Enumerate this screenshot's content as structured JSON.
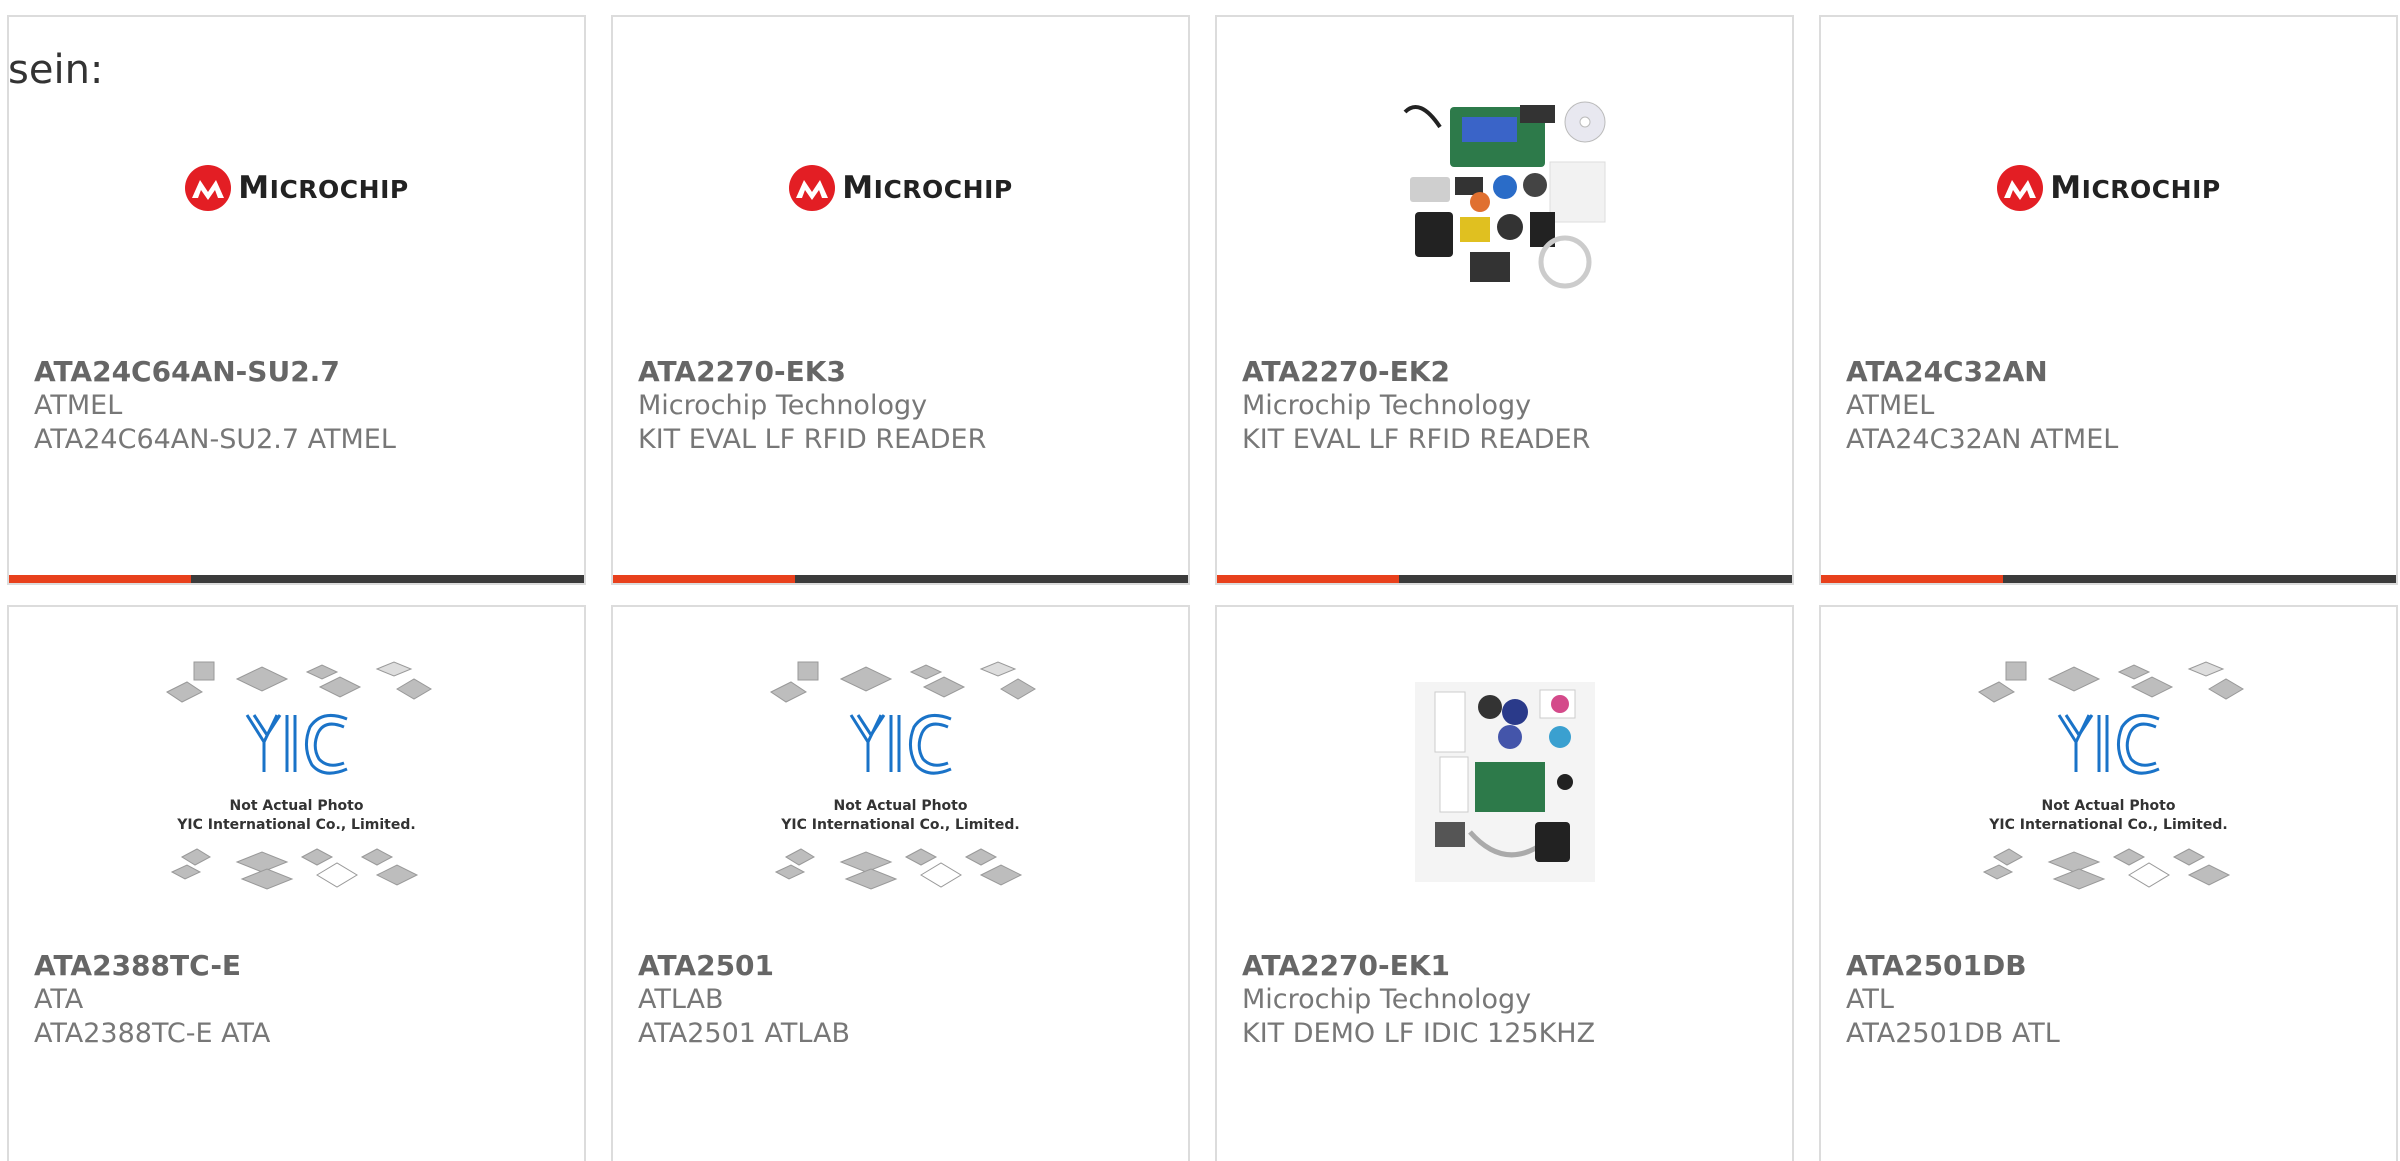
{
  "intro_text": "sein:",
  "products": [
    {
      "part": "ATA24C64AN-SU2.7",
      "manufacturer": "ATMEL",
      "description": "ATA24C64AN-SU2.7 ATMEL",
      "image": "microchip-logo"
    },
    {
      "part": "ATA2270-EK3",
      "manufacturer": "Microchip Technology",
      "description": "KIT EVAL LF RFID READER",
      "image": "microchip-logo"
    },
    {
      "part": "ATA2270-EK2",
      "manufacturer": "Microchip Technology",
      "description": "KIT EVAL LF RFID READER",
      "image": "kit-photo"
    },
    {
      "part": "ATA24C32AN",
      "manufacturer": "ATMEL",
      "description": "ATA24C32AN ATMEL",
      "image": "microchip-logo"
    },
    {
      "part": "ATA2388TC-E",
      "manufacturer": "ATA",
      "description": "ATA2388TC-E ATA",
      "image": "not-actual-photo"
    },
    {
      "part": "ATA2501",
      "manufacturer": "ATLAB",
      "description": "ATA2501 ATLAB",
      "image": "not-actual-photo"
    },
    {
      "part": "ATA2270-EK1",
      "manufacturer": "Microchip Technology",
      "description": "KIT DEMO LF IDIC 125KHZ",
      "image": "kit-photo"
    },
    {
      "part": "ATA2501DB",
      "manufacturer": "ATL",
      "description": "ATA2501DB ATL",
      "image": "not-actual-photo"
    }
  ],
  "logo": {
    "brand": "Microchip",
    "wordmark_first": "M",
    "wordmark_rest": "ICROCHIP"
  },
  "placeholder": {
    "line1": "Not Actual Photo",
    "line2": "YIC International Co., Limited.",
    "mark": "YIC"
  },
  "colors": {
    "accent": "#e8401c",
    "bar": "#3b3b3b",
    "logo_red": "#e31e24",
    "yic_blue": "#1a73c8"
  }
}
